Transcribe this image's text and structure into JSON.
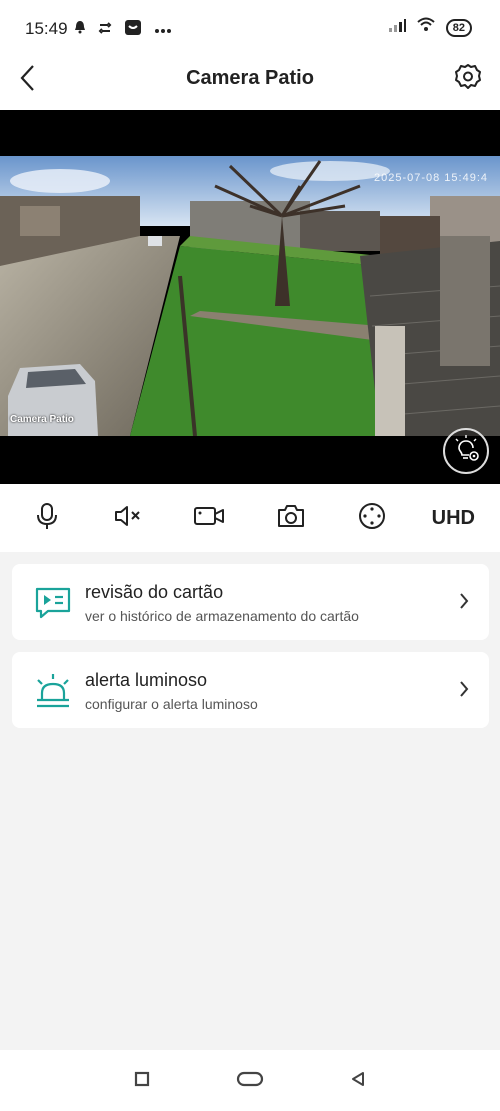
{
  "status_bar": {
    "time": "15:49",
    "battery": "82",
    "icons_left": [
      "alarm-icon",
      "cast-icon",
      "shopee-icon",
      "more-dots-icon"
    ],
    "icons_right": [
      "signal-icon",
      "wifi-icon",
      "battery-icon"
    ]
  },
  "header": {
    "title": "Camera Patio"
  },
  "video": {
    "camera_name": "Camera Patio",
    "timestamp": "2025-07-08 15:49:4"
  },
  "toolbar": {
    "items": [
      "microphone-icon",
      "mute-icon",
      "record-icon",
      "snapshot-icon",
      "ptz-icon"
    ],
    "quality": "UHD"
  },
  "cards": [
    {
      "title": "revisão do cartão",
      "subtitle": "ver o histórico de armazenamento do cartão",
      "icon": "card-playback-icon"
    },
    {
      "title": "alerta luminoso",
      "subtitle": "configurar o alerta luminoso",
      "icon": "siren-icon"
    }
  ],
  "colors": {
    "accent": "#1aa39a",
    "background": "#f3f3f3"
  }
}
